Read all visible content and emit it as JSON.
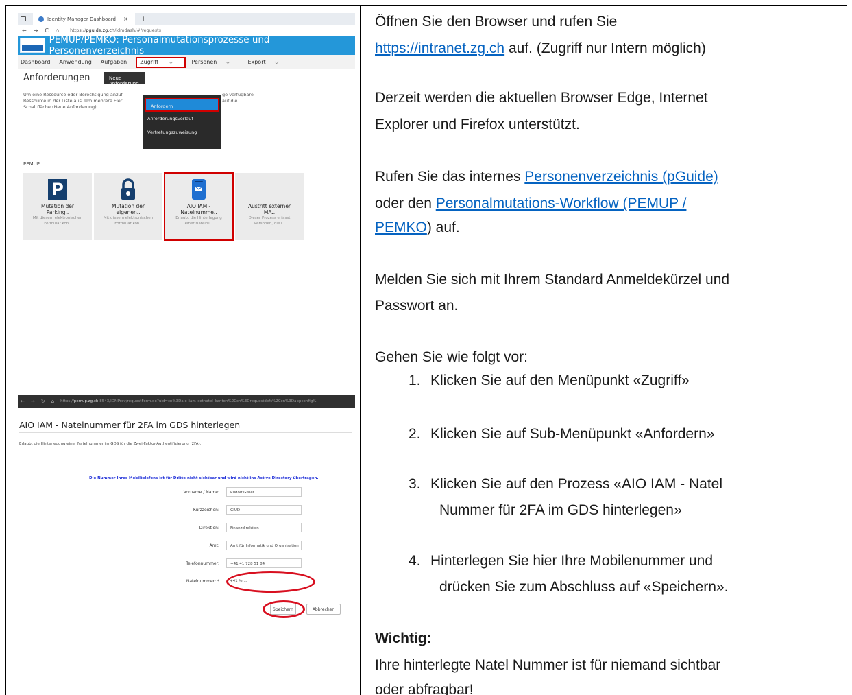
{
  "shot1": {
    "tab_title": "Identity Manager Dashboard",
    "tab_close": "×",
    "tab_new": "+",
    "nav_back": "←",
    "nav_forward": "→",
    "nav_reload": "C",
    "nav_home": "⌂",
    "url_prefix": "https://",
    "url_host": "pguide.zg.ch",
    "url_path": "/idmdash/#/requests",
    "banner_title": "PEMUP/PEMKO: Personalmutationsprozesse und Personenverzeichnis",
    "nav": [
      "Dashboard",
      "Anwendung",
      "Aufgaben",
      "Zugriff",
      "Personen",
      "Export"
    ],
    "chevron": "⌵",
    "heading": "Anforderungen",
    "new_button": "Neue Anforderung",
    "description_lines": [
      "Um eine Ressource oder Berechtigung anzuf",
      "Ressource in der Liste aus. Um mehrere Eler",
      "Schaltfläche (Neue Anforderung)."
    ],
    "description_right_lines": [
      "ge verfügbare",
      "auf die"
    ],
    "dropdown": [
      "Anfordern",
      "Anforderungsverlauf",
      "Vertretungszuweisung"
    ],
    "section": "PEMUP",
    "tiles": [
      {
        "title": [
          "Mutation der",
          "Parking.."
        ],
        "sub": [
          "Mit diesem elektronischen",
          "Formular kön.."
        ],
        "icon": "parking-icon"
      },
      {
        "title": [
          "Mutation der",
          "eigenen.."
        ],
        "sub": [
          "Mit diesem elektronischen",
          "Formular kön.."
        ],
        "icon": "lock-icon"
      },
      {
        "title": [
          "AIO IAM -",
          "Natelnumme.."
        ],
        "sub": [
          "Erlaubt die Hinterlegung",
          "einer Natelnu.."
        ],
        "icon": "mobile-phone-icon"
      },
      {
        "title": [
          "Austritt externer",
          "MA.."
        ],
        "sub": [
          "Dieser Prozess erfasst",
          "Personen, die i.."
        ],
        "icon": "none"
      }
    ]
  },
  "shot2": {
    "url_prefix": "https://",
    "url_host": "pemup.zg.ch",
    "url_rest": ":8543/IDMProv/requestForm.do?uid=cn%3Daio_iam_setnatel_kanton%2Ccn%3Drequestdefs%2Ccn%3Dappconfig%",
    "title": "AIO IAM - Natelnummer für 2FA im GDS hinterlegen",
    "description": "Erlaubt die Hinterlegung einer Natelnummer im GDS für die Zwei-Faktor-Authentifizierung (2FA).",
    "note": "Die Nummer Ihres Mobiltelefons ist für Dritte nicht sichtbar und wird nicht ins Active Directory übertragen.",
    "fields": [
      {
        "label": "Vorname / Name:",
        "value": "Rudolf Gisler"
      },
      {
        "label": "Kurzzeichen:",
        "value": "GIUD"
      },
      {
        "label": "Direktion:",
        "value": "Finanzdirektion"
      },
      {
        "label": "Amt:",
        "value": "Amt für Informatik und Organisation"
      },
      {
        "label": "Telefonnummer:",
        "value": "+41 41 728 51 84"
      },
      {
        "label": "Natelnummer: *",
        "value": "+41 /e ..."
      }
    ],
    "save_button": "Speichern",
    "cancel_button": "Abbrechen"
  },
  "right": {
    "p1_line1": "Öffnen Sie den Browser und rufen Sie",
    "p1_link": "https://intranet.zg.ch",
    "p1_rest": " auf. (Zugriff nur Intern möglich)",
    "p2_line1": "Derzeit werden die aktuellen Browser Edge, Internet",
    "p2_line2": "Explorer und Firefox unterstützt.",
    "p3_pre": "Rufen Sie das internes ",
    "p3_link1": "Personenverzeichnis (pGuide)",
    "p3_mid": "oder den ",
    "p3_link2a": "Personalmutations-Workflow (PEMUP /",
    "p3_link2b": "PEMKO",
    "p3_post": ") auf.",
    "p4_line1": "Melden Sie sich mit Ihrem Standard Anmeldekürzel und",
    "p4_line2": "Passwort an.",
    "p5": "Gehen Sie wie folgt vor:",
    "steps": [
      {
        "num": "1.",
        "lines": [
          "Klicken Sie auf den Menüpunkt «Zugriff»"
        ]
      },
      {
        "num": "2.",
        "lines": [
          "Klicken Sie auf Sub-Menüpunkt «Anfordern»"
        ]
      },
      {
        "num": "3.",
        "lines": [
          "Klicken Sie auf den Prozess «AIO IAM - Natel",
          "Nummer für 2FA im GDS hinterlegen»"
        ]
      },
      {
        "num": "4.",
        "lines": [
          "Hinterlegen Sie hier Ihre Mobilenummer und",
          "drücken Sie zum Abschluss auf «Speichern»."
        ]
      }
    ],
    "important_heading": "Wichtig:",
    "important_line1": "Ihre hinterlegte Natel Nummer ist für niemand sichtbar",
    "important_line2": "oder abfragbar!"
  }
}
